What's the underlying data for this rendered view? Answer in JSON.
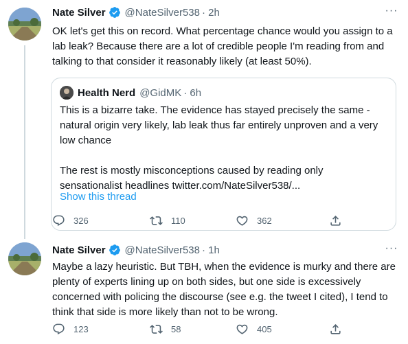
{
  "tweets": [
    {
      "name": "Nate Silver",
      "handle": "@NateSilver538",
      "time": "· 2h",
      "text": "OK let's get this on record. What percentage chance would you assign to a lab leak? Because there are a lot of credible people I'm reading from and talking to that consider it reasonably likely (at least 50%).",
      "quote": {
        "name": "Health Nerd",
        "handle": "@GidMK",
        "time": "· 6h",
        "text": "This is a bizarre take. The evidence has stayed precisely the same - natural origin very likely, lab leak thus far entirely unproven and a very low chance\n\nThe rest is mostly misconceptions caused by reading only sensationalist headlines twitter.com/NateSilver538/...",
        "show_thread": "Show this thread"
      },
      "replies": "326",
      "retweets": "110",
      "likes": "362"
    },
    {
      "name": "Nate Silver",
      "handle": "@NateSilver538",
      "time": "· 1h",
      "text": "Maybe a lazy heuristic. But TBH, when the evidence is murky and there are plenty of experts lining up on both sides, but one side is excessively concerned with policing the discourse (see e.g. the tweet I cited), I tend to think that side is more likely than not to be wrong.",
      "replies": "123",
      "retweets": "58",
      "likes": "405"
    }
  ],
  "colors": {
    "accent": "#1d9bf0",
    "text": "#0f1419",
    "muted": "#536471",
    "border": "#cfd9de"
  },
  "icons": {
    "verified": "verified-badge-icon",
    "more": "more-options-icon",
    "reply": "reply-icon",
    "retweet": "retweet-icon",
    "like": "like-icon",
    "share": "share-icon"
  }
}
